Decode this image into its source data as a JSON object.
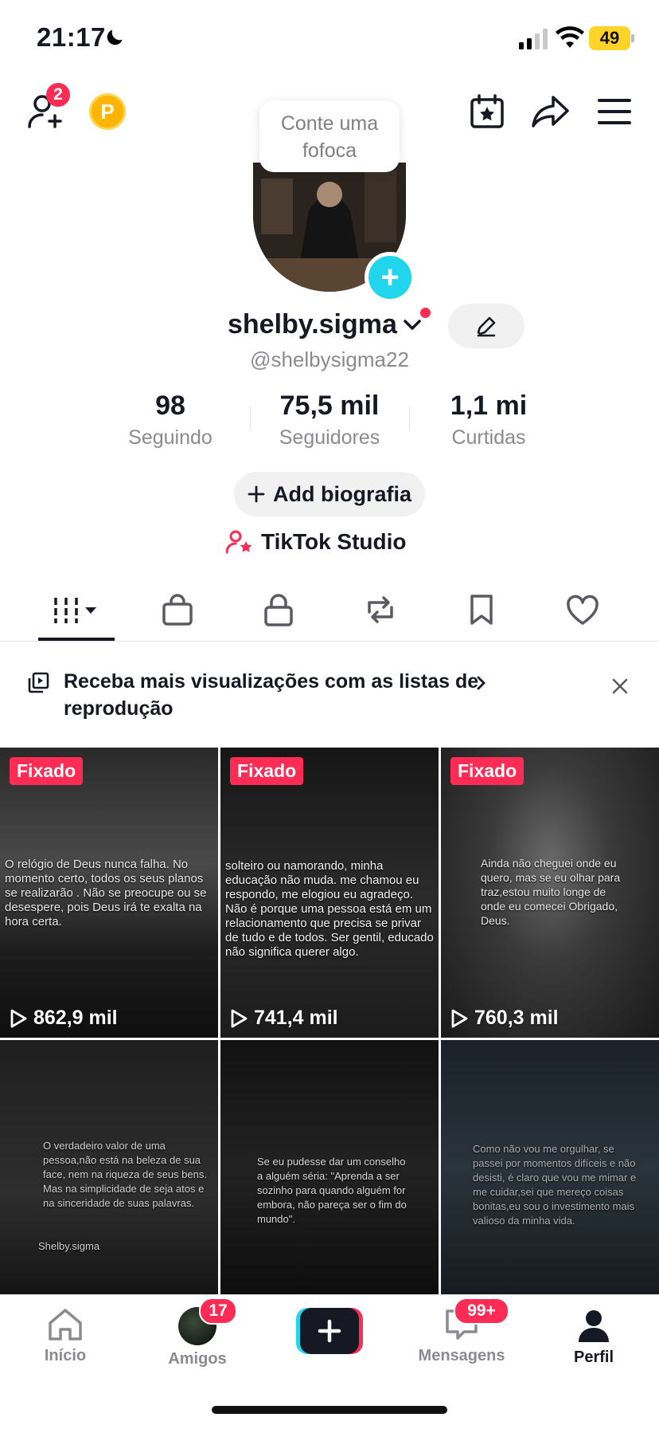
{
  "status_bar": {
    "time": "21:17",
    "battery": "49"
  },
  "header": {
    "add_friends_badge": "2",
    "coin_letter": "P",
    "tooltip": "Conte uma fofoca"
  },
  "profile": {
    "username": "shelby.sigma",
    "handle": "@shelbysigma22",
    "stats": [
      {
        "value": "98",
        "label": "Seguindo"
      },
      {
        "value": "75,5 mil",
        "label": "Seguidores"
      },
      {
        "value": "1,1 mi",
        "label": "Curtidas"
      }
    ],
    "add_bio": "Add biografia",
    "studio": "TikTok Studio"
  },
  "banner": {
    "text": "Receba mais visualizações com as listas de reprodução"
  },
  "videos": [
    {
      "pinned": "Fixado",
      "views": "862,9 mil",
      "caption": "O relógio de Deus nunca falha. No momento certo, todos os seus planos se realizarão . Não se preocupe ou se desespere, pois Deus irá te exalta na hora certa."
    },
    {
      "pinned": "Fixado",
      "views": "741,4 mil",
      "caption": "solteiro ou namorando, minha educação não muda. me chamou eu respondo, me elogiou eu agradeço. Não é porque uma pessoa está em um relacionamento que precisa se privar de tudo e de todos. Ser gentil, educado não significa querer algo."
    },
    {
      "pinned": "Fixado",
      "views": "760,3 mil",
      "caption": "Ainda não cheguei onde eu quero, mas se eu olhar para traz,estou muito longe de onde eu comecei Obrigado, Deus."
    },
    {
      "caption": "O verdadeiro valor de uma pessoa,não está na beleza de sua face, nem na riqueza de seus bens. Mas na simplicidade de seja atos e na sinceridade de suas palavras.",
      "signature": "Shelby.sigma"
    },
    {
      "caption": "Se eu pudesse dar um conselho a alguém séria: \"Aprenda a ser sozinho para quando alguém for embora, não pareça ser o fim do mundo\"."
    },
    {
      "caption": "Como não vou me orgulhar, se passei por momentos difíceis e não desisti, é claro que vou me mimar e me cuidar,sei que mereço coisas bonitas,eu sou o investimento mais valioso da minha vida."
    }
  ],
  "nav": {
    "items": [
      {
        "label": "Início"
      },
      {
        "label": "Amigos",
        "badge": "17"
      },
      {
        "label": ""
      },
      {
        "label": "Mensagens",
        "badge": "99+"
      },
      {
        "label": "Perfil"
      }
    ]
  },
  "colors": {
    "accent": "#fe2c55",
    "cyan": "#20d5ec",
    "text": "#161823",
    "muted": "#8a8b91"
  }
}
